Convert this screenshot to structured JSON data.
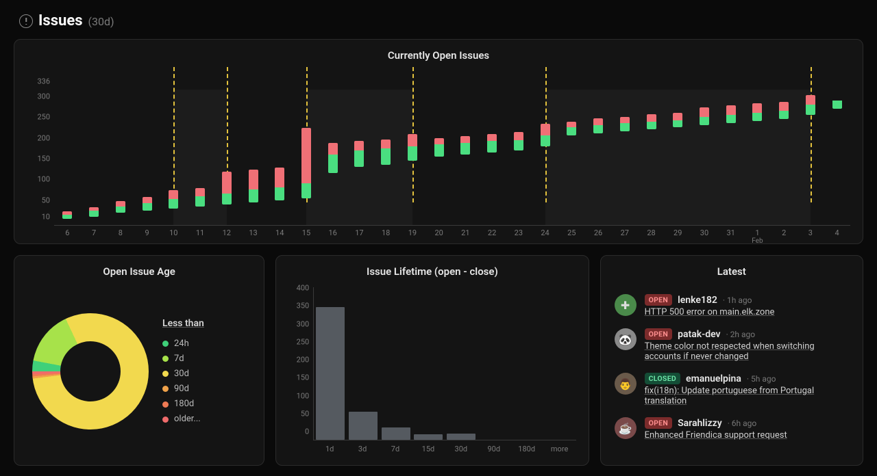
{
  "header": {
    "title": "Issues",
    "period": "(30d)"
  },
  "chart_data": [
    {
      "type": "bar",
      "title": "Currently Open Issues",
      "ylim": [
        10,
        336
      ],
      "y_ticks": [
        10,
        50,
        100,
        150,
        200,
        250,
        300,
        336
      ],
      "x_labels": [
        "6",
        "7",
        "8",
        "9",
        "10",
        "11",
        "12",
        "13",
        "14",
        "15",
        "16",
        "17",
        "18",
        "19",
        "20",
        "21",
        "22",
        "23",
        "24",
        "25",
        "26",
        "27",
        "28",
        "29",
        "30",
        "31",
        "1",
        "2",
        "3",
        "4"
      ],
      "x_month_label": {
        "index": 26,
        "text": "Feb"
      },
      "vertical_markers_x_index": [
        4,
        6,
        9,
        13,
        18,
        28
      ],
      "area_ranges_x_index": [
        [
          4,
          6
        ],
        [
          9,
          13
        ],
        [
          18,
          28
        ]
      ],
      "series": [
        {
          "name": "green_low",
          "values": [
            25,
            30,
            40,
            45,
            50,
            55,
            60,
            65,
            70,
            75,
            135,
            150,
            155,
            165,
            175,
            180,
            185,
            190,
            200,
            225,
            230,
            235,
            240,
            245,
            250,
            255,
            260,
            265,
            275,
            290
          ]
        },
        {
          "name": "green_high",
          "values": [
            35,
            45,
            55,
            62,
            72,
            80,
            85,
            95,
            100,
            110,
            180,
            190,
            195,
            200,
            205,
            207,
            212,
            215,
            225,
            245,
            250,
            255,
            258,
            262,
            270,
            275,
            280,
            285,
            300,
            310
          ]
        },
        {
          "name": "red_high",
          "values": [
            45,
            55,
            70,
            80,
            95,
            100,
            140,
            145,
            150,
            245,
            210,
            215,
            218,
            230,
            220,
            225,
            230,
            235,
            255,
            260,
            268,
            272,
            278,
            282,
            295,
            300,
            305,
            308,
            325,
            310
          ]
        }
      ]
    },
    {
      "type": "pie",
      "title": "Open Issue Age",
      "legend_title": "Less than",
      "slices": [
        {
          "label": "24h",
          "value": 3,
          "color": "#3fd07a"
        },
        {
          "label": "7d",
          "value": 15,
          "color": "#a7e24a"
        },
        {
          "label": "30d",
          "value": 80,
          "color": "#f2d94e"
        },
        {
          "label": "90d",
          "value": 0.6,
          "color": "#f0a24a"
        },
        {
          "label": "180d",
          "value": 0.6,
          "color": "#ef7a54"
        },
        {
          "label": "older...",
          "value": 0.8,
          "color": "#ef6b6b"
        }
      ]
    },
    {
      "type": "bar",
      "title": "Issue Lifetime (open - close)",
      "ylim": [
        0,
        400
      ],
      "y_ticks": [
        0,
        50,
        100,
        150,
        200,
        250,
        300,
        350,
        400
      ],
      "categories": [
        "1d",
        "3d",
        "7d",
        "15d",
        "30d",
        "90d",
        "180d",
        "more"
      ],
      "values": [
        370,
        78,
        35,
        15,
        18,
        0,
        0,
        0
      ]
    }
  ],
  "latest": {
    "title": "Latest",
    "items": [
      {
        "status": "OPEN",
        "user": "lenke182",
        "time": "· 1h ago",
        "title": "HTTP 500 error on main.elk.zone",
        "avatar_bg": "#4a8a4a",
        "avatar_glyph": "✚"
      },
      {
        "status": "OPEN",
        "user": "patak-dev",
        "time": "· 2h ago",
        "title": "Theme color not respected when switching accounts if never changed",
        "avatar_bg": "#8a8a8a",
        "avatar_glyph": "🐼"
      },
      {
        "status": "CLOSED",
        "user": "emanuelpina",
        "time": "· 5h ago",
        "title": "fix(i18n): Update portuguese from Portugal translation",
        "avatar_bg": "#6a5a4a",
        "avatar_glyph": "👨"
      },
      {
        "status": "OPEN",
        "user": "Sarahlizzy",
        "time": "· 6h ago",
        "title": "Enhanced Friendica support request",
        "avatar_bg": "#7a4a4a",
        "avatar_glyph": "☕"
      }
    ]
  }
}
